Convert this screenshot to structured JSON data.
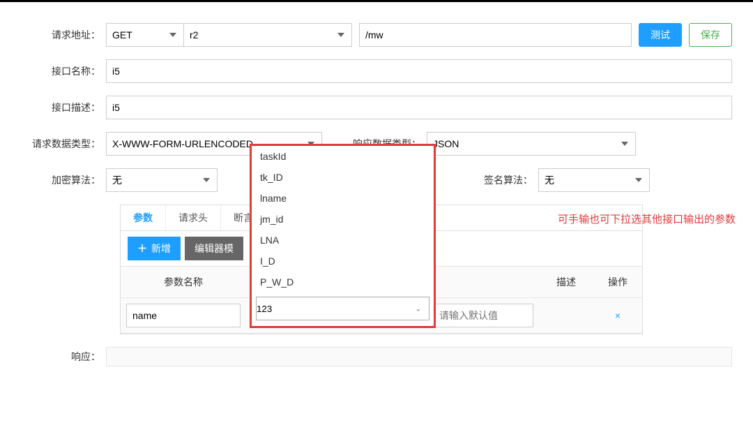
{
  "labels": {
    "request_url": "请求地址：",
    "interface_name": "接口名称：",
    "interface_desc": "接口描述：",
    "request_data_type": "请求数据类型：",
    "response_data_type": "响应数据类型：",
    "encrypt_algo": "加密算法：",
    "sign_algo": "签名算法：",
    "response": "响应："
  },
  "buttons": {
    "test": "测试",
    "save": "保存",
    "add": "新增",
    "editor_mode": "编辑器模"
  },
  "form": {
    "method": "GET",
    "host": "r2",
    "path": "/mw",
    "name": "i5",
    "desc": "i5",
    "req_type": "X-WWW-FORM-URLENCODED",
    "resp_type": "JSON",
    "encrypt": "无",
    "sign": "无"
  },
  "tabs": {
    "params": "参数",
    "headers": "请求头",
    "assert": "断言"
  },
  "table": {
    "headers": {
      "param_name": "参数名称",
      "desc": "描述",
      "op": "操作"
    },
    "row": {
      "name": "name",
      "value": "123",
      "default_placeholder": "请输入默认值",
      "del": "×"
    }
  },
  "dropdown": {
    "options": [
      "taskId",
      "tk_ID",
      "lname",
      "jm_id",
      "LNA",
      "I_D",
      "P_W_D"
    ],
    "input_value": "123"
  },
  "annotation": "可手输也可下拉选其他接口输出的参数",
  "icons": {
    "plus": "＋",
    "chevron": "⌄"
  }
}
